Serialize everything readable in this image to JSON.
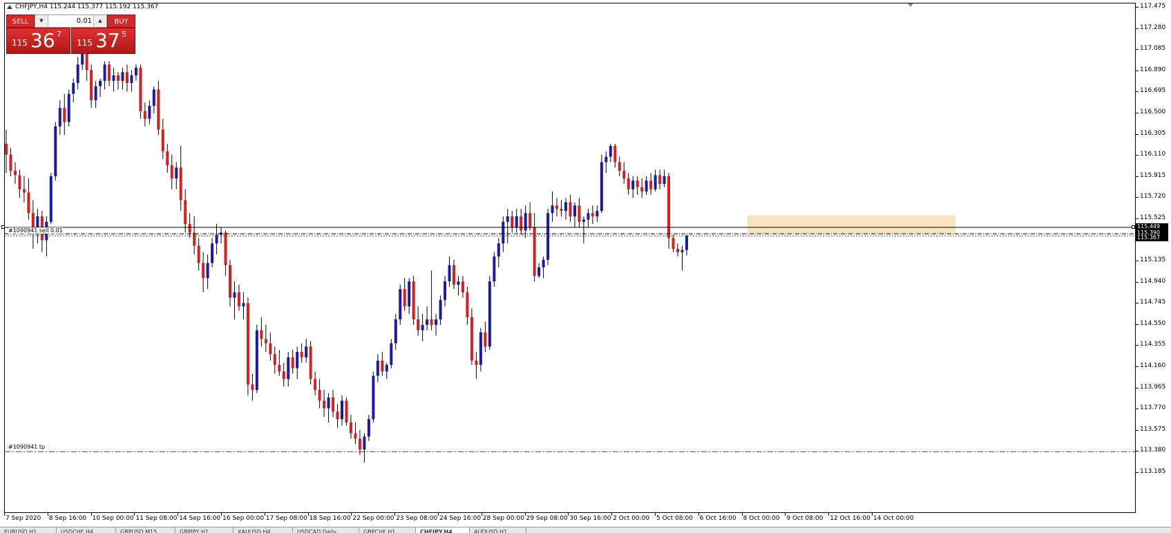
{
  "chart": {
    "symbol_info": "CHFJPY,H4  115.244 115.377 115.192 115.367",
    "y_min": 113.185,
    "y_max": 117.475
  },
  "trade_panel": {
    "sell_label": "SELL",
    "buy_label": "BUY",
    "lot": "0.01",
    "sell_price": {
      "small": "115",
      "big": "36",
      "sup": "7"
    },
    "buy_price": {
      "small": "115",
      "big": "37",
      "sup": "5"
    }
  },
  "price_axis": [
    "117.475",
    "117.280",
    "117.085",
    "116.890",
    "116.695",
    "116.500",
    "116.305",
    "116.110",
    "115.915",
    "115.720",
    "115.525",
    "115.330",
    "115.135",
    "114.940",
    "114.745",
    "114.550",
    "114.355",
    "114.160",
    "113.965",
    "113.770",
    "113.575",
    "113.380",
    "113.185"
  ],
  "time_axis": [
    "7 Sep 2020",
    "8 Sep 16:00",
    "10 Sep 00:00",
    "11 Sep 08:00",
    "14 Sep 16:00",
    "16 Sep 00:00",
    "17 Sep 08:00",
    "18 Sep 16:00",
    "22 Sep 00:00",
    "23 Sep 08:00",
    "24 Sep 16:00",
    "28 Sep 00:00",
    "29 Sep 08:00",
    "30 Sep 16:00",
    "2 Oct 00:00",
    "5 Oct 08:00",
    "6 Oct 16:00",
    "8 Oct 00:00",
    "9 Oct 08:00",
    "12 Oct 16:00",
    "14 Oct 00:00"
  ],
  "orders": {
    "sell_label": "#1090941 sell 0.01",
    "tp_label": "#1090941 tp",
    "line_price": 115.449,
    "entry_price": 115.39,
    "tp_price": 113.38,
    "price_tags": [
      "115.449",
      "115.390",
      "115.367"
    ]
  },
  "tabs": [
    "EURUSD,H1",
    "USDCHF,H4",
    "GBPUSD,M15",
    "GBPJPY,H1",
    "XAUUSD,H4",
    "USDCAD,Daily",
    "GBPCHF,H1",
    "CHFJPY,H4",
    "AUDUSD,H1"
  ],
  "active_tab": "CHFJPY,H4",
  "colors": {
    "bull": "#1a1aa8",
    "bear": "#d81e1e",
    "order_line": "#000000",
    "tp_line": "#d81e1e",
    "zone": "#f7e1b5"
  },
  "chart_data": {
    "type": "candlestick",
    "candles": [
      [
        116.22,
        116.35,
        115.95,
        116.12
      ],
      [
        116.12,
        116.18,
        115.92,
        115.97
      ],
      [
        115.97,
        116.05,
        115.85,
        115.93
      ],
      [
        115.93,
        115.98,
        115.72,
        115.8
      ],
      [
        115.8,
        115.92,
        115.68,
        115.77
      ],
      [
        115.77,
        115.9,
        115.52,
        115.58
      ],
      [
        115.58,
        115.7,
        115.25,
        115.45
      ],
      [
        115.45,
        115.62,
        115.3,
        115.55
      ],
      [
        115.55,
        115.6,
        115.22,
        115.33
      ],
      [
        115.33,
        115.55,
        115.18,
        115.5
      ],
      [
        115.5,
        115.95,
        115.48,
        115.92
      ],
      [
        115.92,
        116.42,
        115.88,
        116.38
      ],
      [
        116.38,
        116.62,
        116.3,
        116.55
      ],
      [
        116.55,
        116.68,
        116.3,
        116.42
      ],
      [
        116.42,
        116.72,
        116.38,
        116.68
      ],
      [
        116.68,
        116.82,
        116.6,
        116.78
      ],
      [
        116.78,
        117.02,
        116.72,
        116.95
      ],
      [
        116.95,
        117.15,
        116.9,
        117.08
      ],
      [
        117.08,
        117.12,
        116.8,
        116.9
      ],
      [
        116.9,
        116.95,
        116.55,
        116.62
      ],
      [
        116.62,
        116.8,
        116.55,
        116.75
      ],
      [
        116.75,
        116.82,
        116.65,
        116.8
      ],
      [
        116.8,
        116.98,
        116.72,
        116.95
      ],
      [
        116.95,
        116.98,
        116.75,
        116.8
      ],
      [
        116.8,
        116.92,
        116.7,
        116.85
      ],
      [
        116.85,
        116.88,
        116.72,
        116.8
      ],
      [
        116.8,
        116.92,
        116.72,
        116.88
      ],
      [
        116.88,
        116.95,
        116.7,
        116.78
      ],
      [
        116.78,
        116.9,
        116.7,
        116.85
      ],
      [
        116.85,
        116.95,
        116.8,
        116.92
      ],
      [
        116.92,
        116.95,
        116.45,
        116.52
      ],
      [
        116.52,
        116.6,
        116.38,
        116.45
      ],
      [
        116.45,
        116.62,
        116.4,
        116.57
      ],
      [
        116.57,
        116.75,
        116.5,
        116.72
      ],
      [
        116.72,
        116.8,
        116.3,
        116.35
      ],
      [
        116.35,
        116.45,
        116.08,
        116.15
      ],
      [
        116.15,
        116.22,
        115.95,
        116.02
      ],
      [
        116.02,
        116.12,
        115.8,
        115.9
      ],
      [
        115.9,
        116.05,
        115.8,
        116.0
      ],
      [
        116.0,
        116.2,
        115.6,
        115.7
      ],
      [
        115.7,
        115.8,
        115.4,
        115.48
      ],
      [
        115.48,
        115.58,
        115.35,
        115.4
      ],
      [
        115.4,
        115.55,
        115.2,
        115.28
      ],
      [
        115.28,
        115.35,
        115.05,
        115.12
      ],
      [
        115.12,
        115.22,
        114.85,
        114.98
      ],
      [
        114.98,
        115.2,
        114.88,
        115.12
      ],
      [
        115.12,
        115.35,
        115.08,
        115.3
      ],
      [
        115.3,
        115.48,
        115.2,
        115.38
      ],
      [
        115.38,
        115.45,
        115.3,
        115.4
      ],
      [
        115.4,
        115.42,
        115.0,
        115.1
      ],
      [
        115.1,
        115.15,
        114.72,
        114.8
      ],
      [
        114.8,
        114.95,
        114.6,
        114.85
      ],
      [
        114.85,
        114.92,
        114.68,
        114.72
      ],
      [
        114.72,
        114.85,
        114.6,
        114.75
      ],
      [
        114.75,
        114.8,
        113.9,
        114.0
      ],
      [
        114.0,
        114.1,
        113.85,
        113.95
      ],
      [
        113.95,
        114.55,
        113.92,
        114.5
      ],
      [
        114.5,
        114.62,
        114.35,
        114.42
      ],
      [
        114.42,
        114.55,
        114.3,
        114.38
      ],
      [
        114.38,
        114.48,
        114.22,
        114.28
      ],
      [
        114.28,
        114.35,
        114.1,
        114.18
      ],
      [
        114.18,
        114.32,
        114.08,
        114.12
      ],
      [
        114.12,
        114.2,
        113.98,
        114.05
      ],
      [
        114.05,
        114.3,
        113.98,
        114.25
      ],
      [
        114.25,
        114.32,
        114.1,
        114.15
      ],
      [
        114.15,
        114.35,
        114.05,
        114.3
      ],
      [
        114.3,
        114.38,
        114.2,
        114.25
      ],
      [
        114.25,
        114.42,
        114.2,
        114.35
      ],
      [
        114.35,
        114.4,
        114.0,
        114.05
      ],
      [
        114.05,
        114.12,
        113.9,
        113.95
      ],
      [
        113.95,
        114.05,
        113.78,
        113.85
      ],
      [
        113.85,
        113.95,
        113.7,
        113.78
      ],
      [
        113.78,
        113.92,
        113.65,
        113.88
      ],
      [
        113.88,
        113.95,
        113.7,
        113.75
      ],
      [
        113.75,
        113.82,
        113.6,
        113.68
      ],
      [
        113.68,
        113.9,
        113.62,
        113.85
      ],
      [
        113.85,
        113.88,
        113.62,
        113.65
      ],
      [
        113.65,
        113.72,
        113.5,
        113.55
      ],
      [
        113.55,
        113.65,
        113.45,
        113.5
      ],
      [
        113.5,
        113.58,
        113.35,
        113.4
      ],
      [
        113.4,
        113.55,
        113.28,
        113.52
      ],
      [
        113.52,
        113.72,
        113.48,
        113.68
      ],
      [
        113.68,
        114.12,
        113.65,
        114.08
      ],
      [
        114.08,
        114.28,
        114.02,
        114.22
      ],
      [
        114.22,
        114.3,
        114.08,
        114.12
      ],
      [
        114.12,
        114.2,
        114.05,
        114.18
      ],
      [
        114.18,
        114.42,
        114.15,
        114.38
      ],
      [
        114.38,
        114.65,
        114.32,
        114.6
      ],
      [
        114.6,
        114.92,
        114.55,
        114.88
      ],
      [
        114.88,
        114.98,
        114.68,
        114.72
      ],
      [
        114.72,
        114.98,
        114.65,
        114.95
      ],
      [
        114.95,
        115.0,
        114.55,
        114.6
      ],
      [
        114.6,
        114.72,
        114.45,
        114.5
      ],
      [
        114.5,
        114.65,
        114.4,
        114.55
      ],
      [
        114.55,
        114.72,
        114.5,
        114.6
      ],
      [
        114.6,
        115.05,
        114.5,
        114.55
      ],
      [
        114.55,
        114.65,
        114.45,
        114.6
      ],
      [
        114.6,
        114.82,
        114.55,
        114.78
      ],
      [
        114.78,
        115.0,
        114.72,
        114.95
      ],
      [
        114.95,
        115.18,
        114.9,
        115.1
      ],
      [
        115.1,
        115.15,
        114.88,
        114.92
      ],
      [
        114.92,
        115.0,
        114.82,
        114.95
      ],
      [
        114.95,
        115.0,
        114.8,
        114.85
      ],
      [
        114.85,
        114.9,
        114.55,
        114.62
      ],
      [
        114.62,
        114.7,
        114.18,
        114.22
      ],
      [
        114.22,
        114.3,
        114.05,
        114.18
      ],
      [
        114.18,
        114.52,
        114.12,
        114.48
      ],
      [
        114.48,
        114.58,
        114.3,
        114.35
      ],
      [
        114.35,
        115.0,
        114.32,
        114.95
      ],
      [
        114.95,
        115.22,
        114.9,
        115.18
      ],
      [
        115.18,
        115.35,
        115.08,
        115.3
      ],
      [
        115.3,
        115.55,
        115.22,
        115.5
      ],
      [
        115.5,
        115.62,
        115.3,
        115.55
      ],
      [
        115.55,
        115.6,
        115.4,
        115.45
      ],
      [
        115.45,
        115.62,
        115.4,
        115.55
      ],
      [
        115.55,
        115.62,
        115.38,
        115.42
      ],
      [
        115.42,
        115.65,
        115.35,
        115.58
      ],
      [
        115.58,
        115.68,
        115.42,
        115.45
      ],
      [
        115.45,
        115.58,
        114.95,
        115.0
      ],
      [
        115.0,
        115.12,
        114.98,
        115.08
      ],
      [
        115.08,
        115.18,
        114.98,
        115.15
      ],
      [
        115.15,
        115.62,
        115.1,
        115.58
      ],
      [
        115.58,
        115.78,
        115.5,
        115.65
      ],
      [
        115.65,
        115.72,
        115.55,
        115.62
      ],
      [
        115.62,
        115.7,
        115.55,
        115.6
      ],
      [
        115.6,
        115.72,
        115.52,
        115.68
      ],
      [
        115.68,
        115.75,
        115.5,
        115.55
      ],
      [
        115.55,
        115.68,
        115.45,
        115.65
      ],
      [
        115.65,
        115.72,
        115.45,
        115.5
      ],
      [
        115.5,
        115.55,
        115.3,
        115.52
      ],
      [
        115.52,
        115.62,
        115.45,
        115.58
      ],
      [
        115.58,
        115.65,
        115.48,
        115.55
      ],
      [
        115.55,
        115.65,
        115.5,
        115.6
      ],
      [
        115.6,
        116.12,
        115.58,
        116.05
      ],
      [
        116.05,
        116.15,
        115.95,
        116.1
      ],
      [
        116.1,
        116.22,
        116.05,
        116.2
      ],
      [
        116.2,
        116.22,
        116.0,
        116.05
      ],
      [
        116.05,
        116.1,
        115.92,
        115.97
      ],
      [
        115.97,
        116.05,
        115.85,
        115.9
      ],
      [
        115.9,
        115.95,
        115.75,
        115.8
      ],
      [
        115.8,
        115.92,
        115.72,
        115.88
      ],
      [
        115.88,
        115.92,
        115.75,
        115.82
      ],
      [
        115.82,
        115.9,
        115.72,
        115.78
      ],
      [
        115.78,
        115.92,
        115.75,
        115.88
      ],
      [
        115.88,
        115.95,
        115.75,
        115.8
      ],
      [
        115.8,
        115.98,
        115.78,
        115.93
      ],
      [
        115.93,
        115.98,
        115.8,
        115.85
      ],
      [
        115.85,
        115.98,
        115.82,
        115.92
      ],
      [
        115.92,
        115.95,
        115.25,
        115.35
      ],
      [
        115.35,
        115.38,
        115.22,
        115.25
      ],
      [
        115.25,
        115.3,
        115.18,
        115.22
      ],
      [
        115.22,
        115.28,
        115.05,
        115.24
      ],
      [
        115.24,
        115.38,
        115.19,
        115.37
      ]
    ]
  }
}
